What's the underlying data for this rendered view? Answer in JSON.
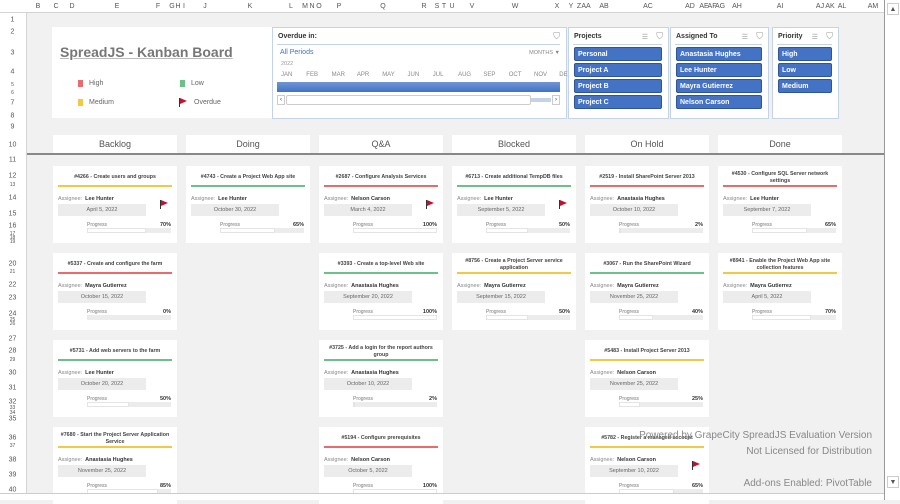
{
  "sheet": {
    "columns": [
      "B",
      "C",
      "D",
      "E",
      "F",
      "G",
      "H",
      "I",
      "J",
      "K",
      "L",
      "M",
      "N",
      "O",
      "P",
      "Q",
      "R",
      "S",
      "T",
      "U",
      "V",
      "W",
      "X",
      "Y",
      "Z",
      "AA",
      "AB",
      "AC",
      "AD",
      "AE",
      "AF",
      "AG",
      "AH",
      "AI",
      "AJ",
      "AK",
      "AL",
      "AM"
    ],
    "rows": [
      "1",
      "2",
      "3",
      "4",
      "5",
      "6",
      "7",
      "8",
      "9",
      "10",
      "11",
      "12",
      "13",
      "14",
      "15",
      "16",
      "17",
      "18",
      "19",
      "20",
      "21",
      "22",
      "23",
      "24",
      "25",
      "26",
      "27",
      "28",
      "29",
      "30",
      "31",
      "32",
      "33",
      "34",
      "35",
      "36",
      "37",
      "38",
      "39",
      "40"
    ]
  },
  "title": "SpreadJS - Kanban Board",
  "legend": {
    "high": "High",
    "low": "Low",
    "medium": "Medium",
    "overdue": "Overdue"
  },
  "colors": {
    "high": "#e96b6b",
    "low": "#6cc18a",
    "medium": "#f3c842",
    "slicer": "#4472c4",
    "flag": "#c8102e"
  },
  "timeline": {
    "header": "Overdue in:",
    "periods": "All Periods",
    "year": "2022",
    "level": "MONTHS",
    "months": [
      "JAN",
      "FEB",
      "MAR",
      "APR",
      "MAY",
      "JUN",
      "JUL",
      "AUG",
      "SEP",
      "OCT",
      "NOV",
      "DEC"
    ]
  },
  "slicers": [
    {
      "title": "Projects",
      "items": [
        "Personal",
        "Project A",
        "Project B",
        "Project C"
      ]
    },
    {
      "title": "Assigned To",
      "items": [
        "Anastasia Hughes",
        "Lee Hunter",
        "Mayra Gutierrez",
        "Nelson Carson"
      ]
    },
    {
      "title": "Priority",
      "items": [
        "High",
        "Low",
        "Medium"
      ]
    }
  ],
  "labels": {
    "assignee": "Assignee:",
    "progress": "Progress"
  },
  "columns": [
    {
      "name": "Backlog",
      "cards": [
        {
          "title": "#4266 - Create users and groups",
          "priority": "medium",
          "assignee": "Lee Hunter",
          "date": "April 5, 2022",
          "progress": "70%",
          "overdue": true
        },
        {
          "title": "#5337 - Create and configure the farm",
          "priority": "high",
          "assignee": "Mayra Gutierrez",
          "date": "October 15, 2022",
          "progress": "0%",
          "overdue": false
        },
        {
          "title": "#5731 - Add web servers to the farm",
          "priority": "low",
          "assignee": "Lee Hunter",
          "date": "October 20, 2022",
          "progress": "50%",
          "overdue": false
        },
        {
          "title": "#7680 - Start the Project Server Application Service",
          "priority": "medium",
          "assignee": "Anastasia Hughes",
          "date": "November 25, 2022",
          "progress": "85%",
          "overdue": false
        }
      ]
    },
    {
      "name": "Doing",
      "cards": [
        {
          "title": "#4743 - Create a Project Web App site",
          "priority": "low",
          "assignee": "Lee Hunter",
          "date": "October 30, 2022",
          "progress": "65%",
          "overdue": false
        }
      ]
    },
    {
      "name": "Q&A",
      "cards": [
        {
          "title": "#2687 - Configure Analysis Services",
          "priority": "high",
          "assignee": "Nelson Carson",
          "date": "March 4, 2022",
          "progress": "100%",
          "overdue": true
        },
        {
          "title": "#3393 - Create a top-level Web site",
          "priority": "low",
          "assignee": "Anastasia Hughes",
          "date": "September 20, 2022",
          "progress": "100%",
          "overdue": false
        },
        {
          "title": "#3725 - Add a login for the report authors group",
          "priority": "low",
          "assignee": "Anastasia Hughes",
          "date": "October 10, 2022",
          "progress": "2%",
          "overdue": false
        },
        {
          "title": "#5194 - Configure prerequisites",
          "priority": "high",
          "assignee": "Nelson Carson",
          "date": "October 5, 2022",
          "progress": "100%",
          "overdue": false
        }
      ]
    },
    {
      "name": "Blocked",
      "cards": [
        {
          "title": "#6713 - Create additional TempDB files",
          "priority": "low",
          "assignee": "Lee Hunter",
          "date": "September 5, 2022",
          "progress": "50%",
          "overdue": true
        },
        {
          "title": "#8756 - Create a Project Server service application",
          "priority": "medium",
          "assignee": "Mayra Gutierrez",
          "date": "September 15, 2022",
          "progress": "50%",
          "overdue": false
        }
      ]
    },
    {
      "name": "On Hold",
      "cards": [
        {
          "title": "#2519 - Install SharePoint Server 2013",
          "priority": "high",
          "assignee": "Anastasia Hughes",
          "date": "October 10, 2022",
          "progress": "2%",
          "overdue": false
        },
        {
          "title": "#3067 - Run the SharePoint Wizard",
          "priority": "low",
          "assignee": "Mayra Gutierrez",
          "date": "November 25, 2022",
          "progress": "40%",
          "overdue": false
        },
        {
          "title": "#5483 - Install Project Server 2013",
          "priority": "medium",
          "assignee": "Nelson Carson",
          "date": "November 25, 2022",
          "progress": "25%",
          "overdue": false
        },
        {
          "title": "#5782 - Register a managed account",
          "priority": "medium",
          "assignee": "Nelson Carson",
          "date": "September 10, 2022",
          "progress": "65%",
          "overdue": true
        }
      ]
    },
    {
      "name": "Done",
      "cards": [
        {
          "title": "#4530 - Configure SQL Server network settings",
          "priority": "high",
          "assignee": "Lee Hunter",
          "date": "September 7, 2022",
          "progress": "65%",
          "overdue": false
        },
        {
          "title": "#8941 - Enable the Project Web App site collection features",
          "priority": "medium",
          "assignee": "Mayra Gutierrez",
          "date": "April 5, 2022",
          "progress": "70%",
          "overdue": false
        }
      ]
    }
  ],
  "watermark": {
    "line1": "Powered by GrapeCity SpreadJS Evaluation Version",
    "line2": "Not Licensed for Distribution",
    "line3": "Add-ons Enabled: PivotTable"
  }
}
